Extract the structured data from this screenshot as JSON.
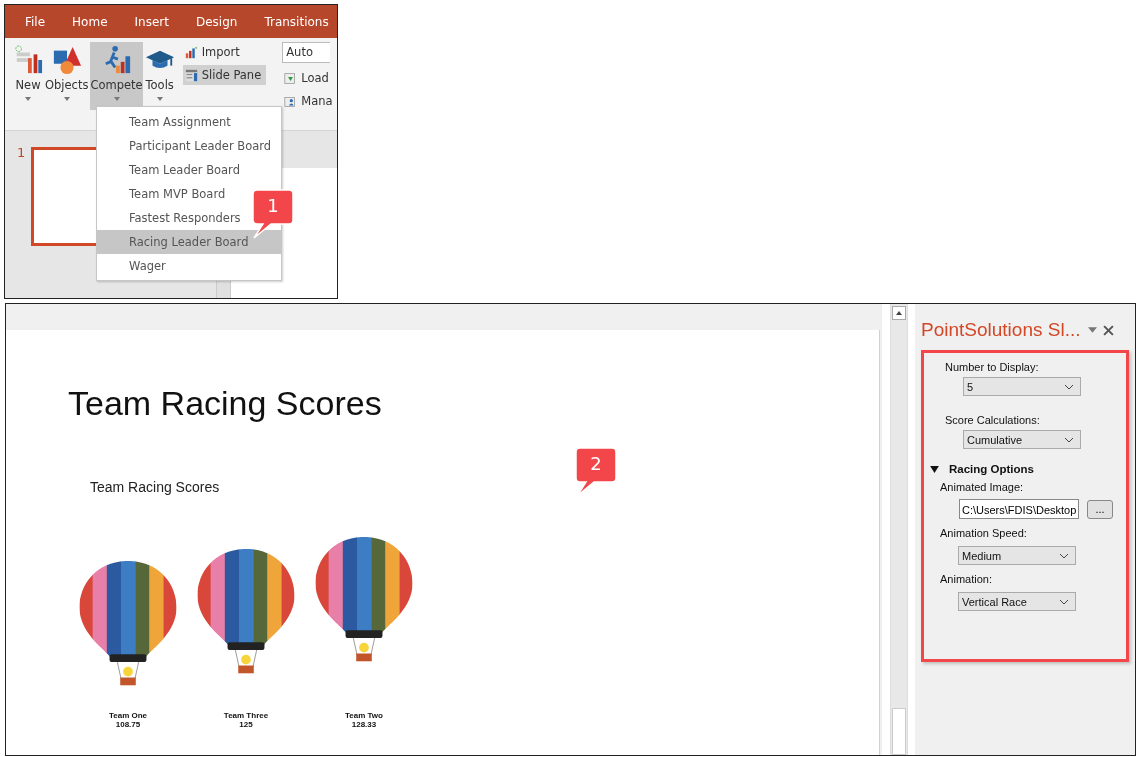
{
  "ribbon_window": {
    "tabs": [
      {
        "label": "File",
        "selected": false
      },
      {
        "label": "Home",
        "selected": false
      },
      {
        "label": "Insert",
        "selected": false
      },
      {
        "label": "Design",
        "selected": false
      },
      {
        "label": "Transitions",
        "selected": false
      }
    ],
    "large_buttons": [
      {
        "kind": "new",
        "label": "New",
        "selected": false
      },
      {
        "kind": "objects",
        "label": "Objects",
        "selected": false
      },
      {
        "kind": "compete",
        "label": "Compete",
        "selected": true
      },
      {
        "kind": "tools",
        "label": "Tools",
        "selected": false
      }
    ],
    "small_buttons": [
      {
        "kind": "import",
        "label": "Import",
        "selected": false
      },
      {
        "kind": "pane",
        "label": "Slide Pane",
        "selected": true
      }
    ],
    "combo": {
      "value": "Auto"
    },
    "side_buttons": [
      {
        "kind": "load",
        "label": "Load"
      },
      {
        "kind": "manage",
        "label": "Mana"
      }
    ],
    "slide_number": "1",
    "menu": [
      {
        "label": "Team Assignment",
        "selected": false
      },
      {
        "label": "Participant Leader Board",
        "selected": false
      },
      {
        "label": "Team Leader Board",
        "selected": false
      },
      {
        "label": "Team MVP Board",
        "selected": false
      },
      {
        "label": "Fastest Responders",
        "selected": false
      },
      {
        "label": "Racing Leader Board",
        "selected": true
      },
      {
        "label": "Wager",
        "selected": false
      }
    ],
    "callout": "1"
  },
  "editor_window": {
    "slide": {
      "title": "Team Racing Scores",
      "chart_title": "Team Racing Scores",
      "teams": [
        {
          "name": "Team One",
          "score": "108.75"
        },
        {
          "name": "Team Three",
          "score": "125"
        },
        {
          "name": "Team Two",
          "score": "128.33"
        }
      ]
    },
    "callout": "2",
    "task_pane": {
      "title": "PointSolutions Sl...",
      "fields": [
        {
          "kind": "select",
          "label": "Number to Display:",
          "value": "5"
        },
        {
          "kind": "select",
          "label": "Score Calculations:",
          "value": "Cumulative"
        }
      ],
      "section": {
        "title": "Racing Options",
        "expanded": true,
        "fields": [
          {
            "kind": "file",
            "label": "Animated Image:",
            "value": "C:\\Users\\FDIS\\Desktop",
            "button": "..."
          },
          {
            "kind": "select",
            "label": "Animation Speed:",
            "value": "Medium"
          },
          {
            "kind": "select",
            "label": "Animation:",
            "value": "Vertical Race"
          }
        ]
      }
    }
  }
}
